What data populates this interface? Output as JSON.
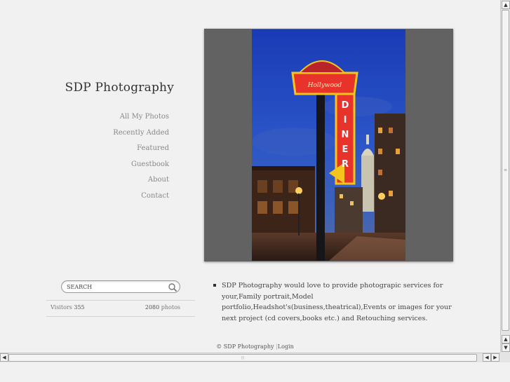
{
  "site": {
    "title": "SDP Photography"
  },
  "nav": {
    "items": [
      {
        "label": "All My Photos"
      },
      {
        "label": "Recently Added"
      },
      {
        "label": "Featured"
      },
      {
        "label": "Guestbook"
      },
      {
        "label": "About"
      },
      {
        "label": "Contact"
      }
    ]
  },
  "photo": {
    "sign_text": "DINER"
  },
  "search": {
    "placeholder": "SEARCH"
  },
  "stats": {
    "visitors_label": "Visitors",
    "visitors_value": "355",
    "photos_count": "2080",
    "photos_label": "photos"
  },
  "blurb": {
    "text": "SDP Photography would love to provide photograpic services for your,Family portrait,Model portfolio,Headshot's(business,theatrical),Events or images for your next project (cd covers,books etc.) and Retouching services."
  },
  "footer": {
    "copyright": "© SDP Photography",
    "separator": "|",
    "login": "Login"
  },
  "colors": {
    "background": "#f1f1f1",
    "frame": "#626262",
    "sky": "#1f3fa8",
    "neon_red": "#e8332a",
    "neon_yellow": "#f6c51d"
  }
}
